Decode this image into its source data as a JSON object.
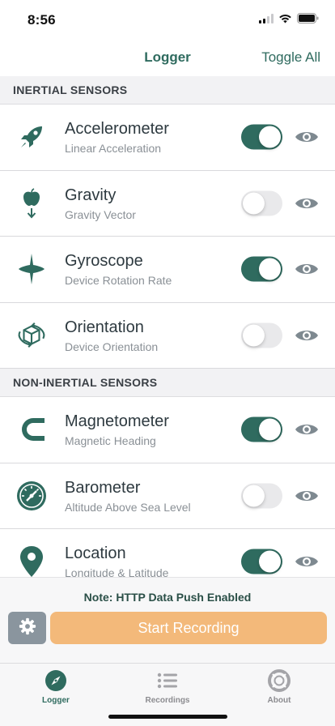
{
  "status_bar": {
    "time": "8:56"
  },
  "nav": {
    "title": "Logger",
    "action": "Toggle All"
  },
  "colors": {
    "accent": "#2f6b5f",
    "record_button": "#f3b97a",
    "toggle_off": "#e9e9eb",
    "eye": "#7e8990"
  },
  "sections": [
    {
      "title": "INERTIAL SENSORS",
      "items": [
        {
          "name": "Accelerometer",
          "description": "Linear Acceleration",
          "enabled": true,
          "icon": "rocket-icon"
        },
        {
          "name": "Gravity",
          "description": "Gravity Vector",
          "enabled": false,
          "icon": "apple-falling-icon"
        },
        {
          "name": "Gyroscope",
          "description": "Device Rotation Rate",
          "enabled": true,
          "icon": "spinning-top-icon"
        },
        {
          "name": "Orientation",
          "description": "Device Orientation",
          "enabled": false,
          "icon": "rotate-cube-icon"
        }
      ]
    },
    {
      "title": "NON-INERTIAL SENSORS",
      "items": [
        {
          "name": "Magnetometer",
          "description": "Magnetic Heading",
          "enabled": true,
          "icon": "magnet-icon"
        },
        {
          "name": "Barometer",
          "description": "Altitude Above Sea Level",
          "enabled": false,
          "icon": "gauge-icon"
        },
        {
          "name": "Location",
          "description": "Longitude & Latitude",
          "enabled": true,
          "icon": "map-pin-icon"
        }
      ]
    }
  ],
  "bottom_panel": {
    "note": "Note: HTTP Data Push Enabled",
    "record_label": "Start Recording",
    "settings_icon": "gear-icon"
  },
  "tabs": [
    {
      "label": "Logger",
      "icon": "compass-icon",
      "active": true
    },
    {
      "label": "Recordings",
      "icon": "list-icon",
      "active": false
    },
    {
      "label": "About",
      "icon": "lifebuoy-icon",
      "active": false
    }
  ]
}
